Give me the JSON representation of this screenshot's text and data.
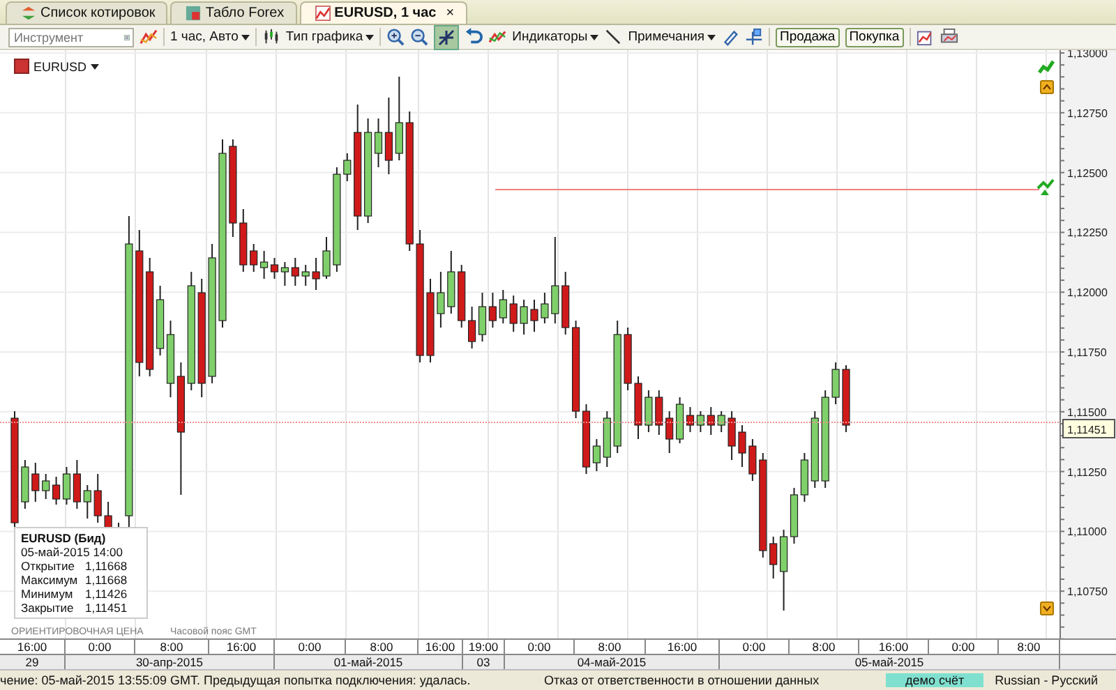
{
  "tabs": [
    {
      "label": "Список котировок",
      "selected": false
    },
    {
      "label": "Табло Forex",
      "selected": false
    },
    {
      "label": "EURUSD, 1 час",
      "selected": true,
      "close": "×"
    }
  ],
  "toolbar": {
    "instrument_placeholder": "Инструмент",
    "timeframe": "1 час, Авто",
    "chart_type": "Тип графика",
    "indicators": "Индикаторы",
    "notes": "Примечания",
    "sell": "Продажа",
    "buy": "Покупка",
    "pan_selected": true
  },
  "chart": {
    "symbol": "EURUSD",
    "price_labels": [
      "1,13000",
      "1,12750",
      "1,12500",
      "1,12250",
      "1,12000",
      "1,11750",
      "1,11500",
      "1,11250",
      "1,11000",
      "1,10750"
    ],
    "current_price": "1,11451",
    "info": {
      "title": "EURUSD (Бид)",
      "time": "05-май-2015 14:00",
      "rows": [
        {
          "label": "Открытие",
          "value": "1,11668"
        },
        {
          "label": "Максимум",
          "value": "1,11668"
        },
        {
          "label": "Минимум",
          "value": "1,11426"
        },
        {
          "label": "Закрытие",
          "value": "1,11451"
        }
      ]
    },
    "price_note": "ОРИЕНТИРОВОЧНАЯ ЦЕНА",
    "timezone": "Часовой пояс GMT"
  },
  "time_axis": {
    "times": [
      "16:00",
      "0:00",
      "8:00",
      "16:00",
      "0:00",
      "8:00",
      "16:00",
      "19:00",
      "0:00",
      "8:00",
      "16:00",
      "0:00",
      "8:00",
      "16:00",
      "0:00",
      "8:00"
    ],
    "dates": [
      "29",
      "30-апр-2015",
      "01-май-2015",
      "03",
      "04-май-2015",
      "05-май-2015"
    ]
  },
  "status_bar": {
    "message": "чение: 05-май-2015 13:55:09 GMT. Предыдущая попытка подключения: удалась.",
    "disclaimer": "Отказ от ответственности в отношении данных",
    "account": "демо счёт",
    "language": "Russian - Русский"
  }
}
